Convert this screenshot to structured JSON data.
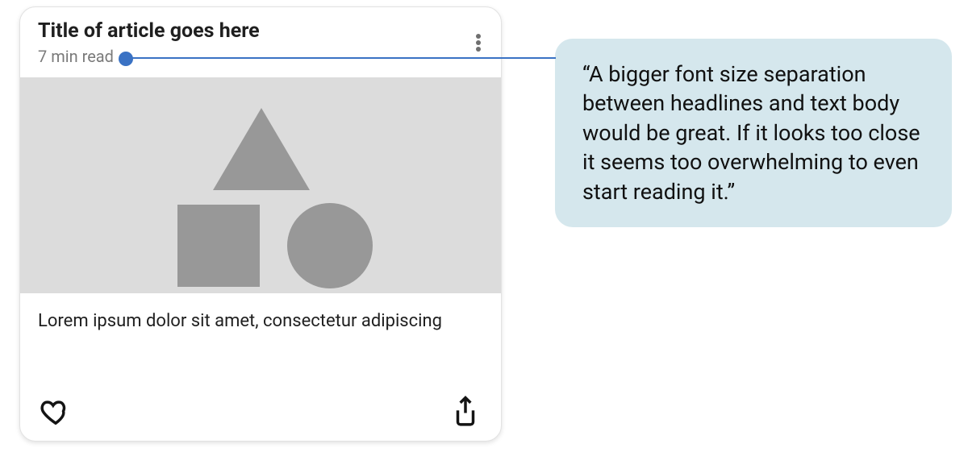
{
  "card": {
    "title": "Title of article goes here",
    "meta": "7 min read",
    "body": "Lorem ipsum dolor sit amet, consectetur adipiscing"
  },
  "callout": {
    "text": "“A bigger font size separation between headlines and text body would be great. If it looks too close it seems too overwhelming to even start reading it.”"
  }
}
